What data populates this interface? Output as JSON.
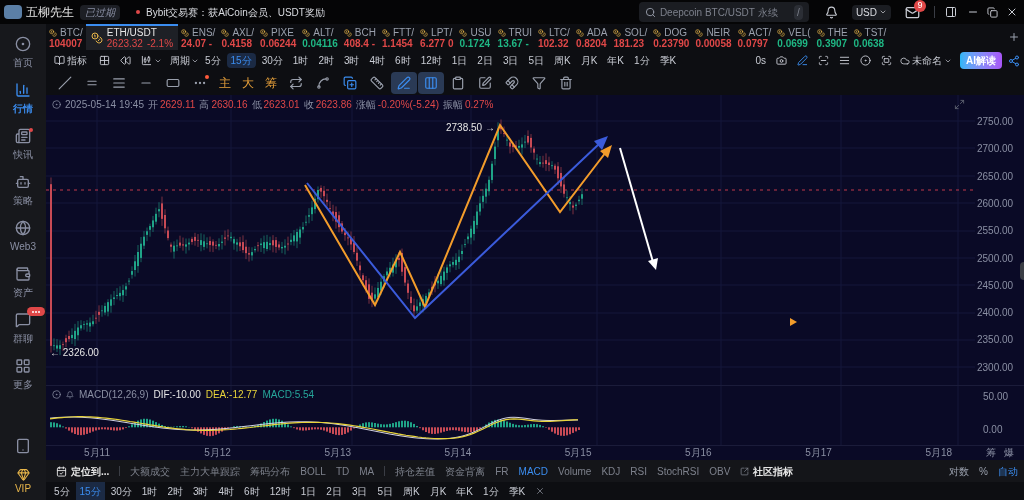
{
  "top_bar": {
    "user": {
      "name": "五柳先生",
      "badge": "已过期"
    },
    "announcement": "Bybit交易赛：获AiCoin会员、USDT奖励",
    "search": {
      "placeholder": "Deepcoin BTC/USDT 永续",
      "shortcut": "/"
    },
    "currency": "USD",
    "mail_count": "9"
  },
  "sidebar": {
    "items": [
      {
        "label": "首页",
        "selected": false
      },
      {
        "label": "行情",
        "selected": true
      },
      {
        "label": "快讯",
        "selected": false
      },
      {
        "label": "策略",
        "selected": false
      },
      {
        "label": "Web3",
        "selected": false
      },
      {
        "label": "资产",
        "selected": false
      },
      {
        "label": "群聊",
        "selected": false
      },
      {
        "label": "更多",
        "selected": false
      }
    ],
    "vip": "VIP"
  },
  "tickers": [
    {
      "name": "BTC/",
      "price": "104007",
      "color": "#e04848",
      "selected": false
    },
    {
      "name": "ETH/USDT",
      "price": "2623.32",
      "change": "-2.1%",
      "color": "#e04848",
      "selected": true
    },
    {
      "name": "ENS/",
      "price": "24.07 -",
      "color": "#e04848",
      "selected": false
    },
    {
      "name": "AXL/",
      "price": "0.4158",
      "color": "#e04848",
      "selected": false
    },
    {
      "name": "PIXE",
      "price": "0.06244",
      "color": "#e04848",
      "selected": false
    },
    {
      "name": "ALT/",
      "price": "0.04116",
      "color": "#1fb784",
      "selected": false
    },
    {
      "name": "BCH",
      "price": "408.4 -",
      "color": "#e04848",
      "selected": false
    },
    {
      "name": "FTT/",
      "price": "1.1454",
      "color": "#e04848",
      "selected": false
    },
    {
      "name": "LPT/",
      "price": "6.277 0",
      "color": "#e04848",
      "selected": false
    },
    {
      "name": "USU",
      "price": "0.1724",
      "color": "#1fb784",
      "selected": false
    },
    {
      "name": "TRUI",
      "price": "13.67 -",
      "color": "#1fb784",
      "selected": false
    },
    {
      "name": "LTC/",
      "price": "102.32",
      "color": "#e04848",
      "selected": false
    },
    {
      "name": "ADA",
      "price": "0.8204",
      "color": "#e04848",
      "selected": false
    },
    {
      "name": "SOL/",
      "price": "181.23",
      "color": "#e04848",
      "selected": false
    },
    {
      "name": "DOG",
      "price": "0.23790",
      "color": "#e04848",
      "selected": false
    },
    {
      "name": "NEIR",
      "price": "0.00058",
      "color": "#e04848",
      "selected": false
    },
    {
      "name": "ACT/",
      "price": "0.0797",
      "color": "#e04848",
      "selected": false
    },
    {
      "name": "VEL(",
      "price": "0.0699",
      "color": "#1fb784",
      "selected": false
    },
    {
      "name": "THE",
      "price": "0.3907",
      "color": "#1fb784",
      "selected": false
    },
    {
      "name": "TST/",
      "price": "0.0638",
      "color": "#1fb784",
      "selected": false
    }
  ],
  "period_bar": {
    "indicator_button": "指标",
    "period_dropdown": "周期",
    "periods": [
      {
        "label": "5分",
        "selected": false
      },
      {
        "label": "15分",
        "selected": true
      },
      {
        "label": "30分",
        "selected": false
      },
      {
        "label": "1时",
        "selected": false
      },
      {
        "label": "2时",
        "selected": false
      },
      {
        "label": "3时",
        "selected": false
      },
      {
        "label": "4时",
        "selected": false
      },
      {
        "label": "6时",
        "selected": false
      },
      {
        "label": "12时",
        "selected": false
      },
      {
        "label": "1日",
        "selected": false
      },
      {
        "label": "2日",
        "selected": false
      },
      {
        "label": "3日",
        "selected": false
      },
      {
        "label": "5日",
        "selected": false
      },
      {
        "label": "周K",
        "selected": false
      },
      {
        "label": "月K",
        "selected": false
      },
      {
        "label": "年K",
        "selected": false
      },
      {
        "label": "1分",
        "selected": false
      },
      {
        "label": "季K",
        "selected": false
      }
    ],
    "countdown": "0s",
    "layout_name": "未命名",
    "ai_button": "AI解读"
  },
  "drawing_tools": [
    {
      "selected": false
    },
    {
      "selected": false
    },
    {
      "selected": false
    },
    {
      "selected": false
    },
    {
      "selected": false
    },
    {
      "selected": false
    },
    {
      "selected": false
    },
    {
      "selected": false
    },
    {
      "selected": false
    },
    {
      "selected": false
    },
    {
      "selected": true
    },
    {
      "selected": true
    },
    {
      "selected": false
    },
    {
      "selected": false
    },
    {
      "selected": false
    },
    {
      "selected": false
    },
    {
      "selected": false
    }
  ],
  "signal_buttons": [
    "主",
    "大",
    "筹"
  ],
  "chart": {
    "info": {
      "datetime": "2025-05-14 19:45",
      "fields": [
        {
          "label": "开",
          "value": "2629.11"
        },
        {
          "label": "高",
          "value": "2630.16"
        },
        {
          "label": "低",
          "value": "2623.01"
        },
        {
          "label": "收",
          "value": "2623.86"
        },
        {
          "label": "涨幅",
          "value": "-0.20%(-5.24)"
        },
        {
          "label": "振幅",
          "value": "0.27%"
        }
      ]
    },
    "high_label": "2738.50 →",
    "low_label": "← 2326.00",
    "price_axis": [
      "2750.00",
      "2700.00",
      "2650.00",
      "2600.00",
      "2550.00",
      "2500.00",
      "2450.00",
      "2400.00",
      "2350.00",
      "2300.00"
    ],
    "macd": {
      "legend": [
        {
          "text": "MACD(12,26,9)",
          "color": "#8a8fa3"
        },
        {
          "text": "DIF:-10.00",
          "color": "#e6e6e6"
        },
        {
          "text": "DEA:-12.77",
          "color": "#e8d43a"
        },
        {
          "text": "MACD:5.54",
          "color": "#26a69a"
        }
      ],
      "axis": [
        "50.00",
        "0.00"
      ]
    },
    "date_axis": [
      "5月11",
      "5月12",
      "5月13",
      "5月14",
      "5月15",
      "5月16",
      "5月17",
      "5月18"
    ],
    "corner_buttons": [
      "筹",
      "爆"
    ]
  },
  "indicator_bar": {
    "locate_button": "定位到...",
    "main": [
      {
        "label": "大额成交",
        "selected": false
      },
      {
        "label": "主力大单跟踪",
        "selected": false
      },
      {
        "label": "筹码分布",
        "selected": false
      },
      {
        "label": "BOLL",
        "selected": false
      },
      {
        "label": "TD",
        "selected": false
      },
      {
        "label": "MA",
        "selected": false
      }
    ],
    "sub": [
      {
        "label": "持仓差值",
        "selected": false
      },
      {
        "label": "资金背离",
        "selected": false
      },
      {
        "label": "FR",
        "selected": false
      },
      {
        "label": "MACD",
        "selected": true
      },
      {
        "label": "Volume",
        "selected": false
      },
      {
        "label": "KDJ",
        "selected": false
      },
      {
        "label": "RSI",
        "selected": false
      },
      {
        "label": "StochRSI",
        "selected": false
      },
      {
        "label": "OBV",
        "selected": false
      }
    ],
    "community": "社区指标",
    "scale_options": [
      {
        "label": "对数",
        "selected": false
      },
      {
        "label": "%",
        "selected": false
      },
      {
        "label": "自动",
        "selected": true
      }
    ]
  },
  "bottom_periods": [
    {
      "label": "5分",
      "selected": false
    },
    {
      "label": "15分",
      "selected": true
    },
    {
      "label": "30分",
      "selected": false
    },
    {
      "label": "1时",
      "selected": false
    },
    {
      "label": "2时",
      "selected": false
    },
    {
      "label": "3时",
      "selected": false
    },
    {
      "label": "4时",
      "selected": false
    },
    {
      "label": "6时",
      "selected": false
    },
    {
      "label": "12时",
      "selected": false
    },
    {
      "label": "1日",
      "selected": false
    },
    {
      "label": "2日",
      "selected": false
    },
    {
      "label": "3日",
      "selected": false
    },
    {
      "label": "5日",
      "selected": false
    },
    {
      "label": "周K",
      "selected": false
    },
    {
      "label": "月K",
      "selected": false
    },
    {
      "label": "年K",
      "selected": false
    },
    {
      "label": "1分",
      "selected": false
    },
    {
      "label": "季K",
      "selected": false
    }
  ]
}
